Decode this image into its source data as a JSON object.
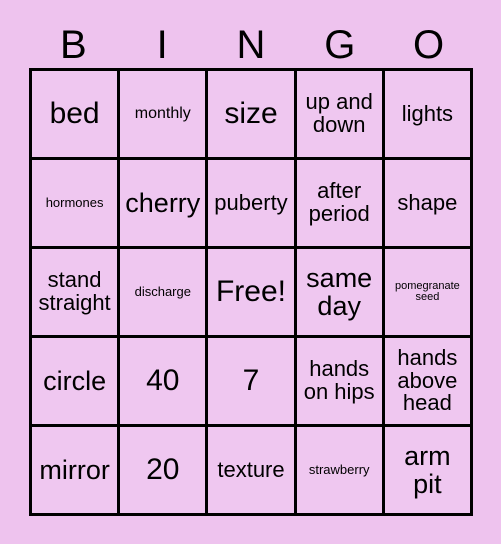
{
  "card": {
    "title": "BINGO",
    "free_space_label": "Free!",
    "colors": {
      "page_background": "#eec3ee",
      "cell_background": "#efc7f0",
      "grid_line": "#000000",
      "text": "#000000"
    },
    "header": {
      "letters": [
        "B",
        "I",
        "N",
        "G",
        "O"
      ]
    },
    "grid": {
      "columns": 5,
      "rows": 5,
      "cells": [
        [
          {
            "text": "bed",
            "size": "xl"
          },
          {
            "text": "monthly",
            "size": "sm"
          },
          {
            "text": "size",
            "size": "xl"
          },
          {
            "text": "up and down",
            "size": "md"
          },
          {
            "text": "lights",
            "size": "md"
          }
        ],
        [
          {
            "text": "hormones",
            "size": "xs"
          },
          {
            "text": "cherry",
            "size": "lg"
          },
          {
            "text": "puberty",
            "size": "md"
          },
          {
            "text": "after period",
            "size": "md"
          },
          {
            "text": "shape",
            "size": "md"
          }
        ],
        [
          {
            "text": "stand straight",
            "size": "md"
          },
          {
            "text": "discharge",
            "size": "xs"
          },
          {
            "text": "Free!",
            "size": "xl"
          },
          {
            "text": "same day",
            "size": "lg"
          },
          {
            "text": "pomegranate seed",
            "size": "xxs"
          }
        ],
        [
          {
            "text": "circle",
            "size": "lg"
          },
          {
            "text": "40",
            "size": "xl"
          },
          {
            "text": "7",
            "size": "xl"
          },
          {
            "text": "hands on hips",
            "size": "md"
          },
          {
            "text": "hands above head",
            "size": "md"
          }
        ],
        [
          {
            "text": "mirror",
            "size": "lg"
          },
          {
            "text": "20",
            "size": "xl"
          },
          {
            "text": "texture",
            "size": "md"
          },
          {
            "text": "strawberry",
            "size": "xs"
          },
          {
            "text": "arm pit",
            "size": "lg"
          }
        ]
      ]
    }
  }
}
